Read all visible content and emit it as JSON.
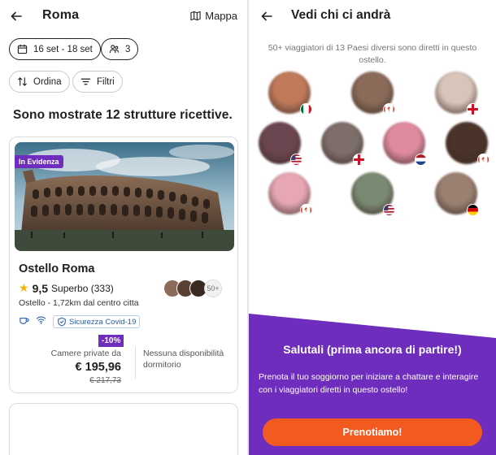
{
  "left": {
    "city": "Roma",
    "map_label": "Mappa",
    "filters": {
      "dates": "16 set - 18 set",
      "guests": "3",
      "sort": "Ordina",
      "filter": "Filtri"
    },
    "results_text": "Sono mostrate 12 strutture ricettive.",
    "listing": {
      "featured_badge": "In Evidenza",
      "name": "Ostello Roma",
      "score": "9,5",
      "rating_text": "Superbo (333)",
      "meta": "Ostello - 1,72km dal centro citta",
      "covid": "Sicurezza Covid-19",
      "more_travellers": "50+",
      "discount": "-10%",
      "private_label": "Camere private da",
      "price": "€ 195,96",
      "old_price": "€ 217,73",
      "no_availability": "Nessuna disponibilità dormitorio"
    }
  },
  "right": {
    "title": "Vedi chi ci andrà",
    "subtitle": "50+ viaggiatori di 13 Paesi diversi sono diretti in questo ostello.",
    "travellers": [
      {
        "flag": "mexico",
        "tone": "#c07a5a"
      },
      {
        "flag": "canada",
        "tone": "#8a6a58"
      },
      {
        "flag": "england",
        "tone": "#d8c4b8"
      },
      {
        "flag": "usa",
        "tone": "#6b4550"
      },
      {
        "flag": "england",
        "tone": "#7d6e6a"
      },
      {
        "flag": "netherlands",
        "tone": "#e08aa0"
      },
      {
        "flag": "canada",
        "tone": "#4a3328"
      },
      {
        "flag": "canada",
        "tone": "#e6a6b4"
      },
      {
        "flag": "usa",
        "tone": "#7a8a72"
      },
      {
        "flag": "germany",
        "tone": "#9a8070"
      }
    ],
    "promo_title": "Salutali (prima ancora di partire!)",
    "promo_text": "Prenota il tuo soggiorno per iniziare a chattare e interagire con i viaggiatori diretti in questo ostello!",
    "cta": "Prenotiamo!"
  },
  "colors": {
    "purple": "#6f2dbd",
    "orange": "#f25a1f",
    "star": "#f4b400"
  }
}
